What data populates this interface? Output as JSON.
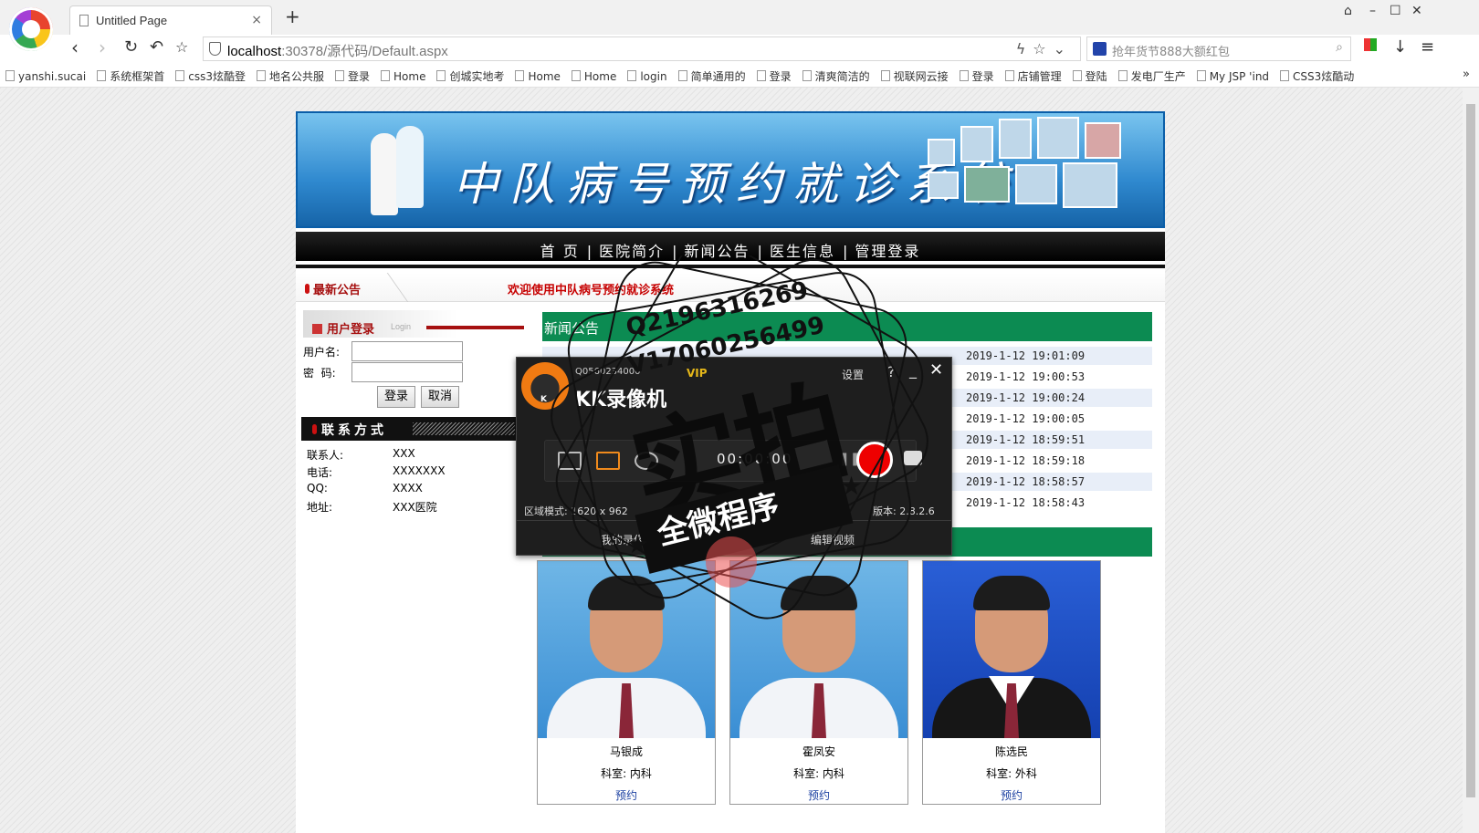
{
  "browser": {
    "tab_title": "Untitled Page",
    "tab_close": "×",
    "new_tab": "+",
    "url_host": "localhost",
    "url_rest": ":30378/源代码/Default.aspx",
    "search_placeholder": "抢年货节888大额红包",
    "bookmarks": [
      "yanshi.sucai",
      "系统框架首",
      "css3炫酷登",
      "地名公共服",
      "登录",
      "Home",
      "创城实地考",
      "Home",
      "Home",
      "login",
      "简单通用的",
      "登录",
      "清爽简洁的",
      "视联网云接",
      "登录",
      "店铺管理",
      "登陆",
      "发电厂生产",
      "My JSP 'ind",
      "CSS3炫酷动"
    ],
    "bookmarks_more": "»"
  },
  "site": {
    "banner_title": "中队病号预约就诊系统",
    "menu": [
      "首 页",
      "医院简介",
      "新闻公告",
      "医生信息",
      "管理登录"
    ],
    "notice_label": "最新公告",
    "notice_text": "欢迎使用中队病号预约就诊系统",
    "login": {
      "title": "用户登录",
      "subtitle": "Login",
      "username_label": "用户名:",
      "password_label": "密  码:",
      "username_value": "",
      "password_value": "",
      "submit": "登录",
      "cancel": "取消"
    },
    "contact": {
      "title": "联系方式",
      "rows": [
        {
          "label": "联系人:",
          "value": "XXX"
        },
        {
          "label": "电话:",
          "value": "XXXXXXX"
        },
        {
          "label": "QQ:",
          "value": "XXXX"
        },
        {
          "label": "地址:",
          "value": "XXX医院"
        }
      ]
    },
    "news": {
      "title": "新闻公告",
      "dates": [
        "2019-1-12 19:01:09",
        "2019-1-12 19:00:53",
        "2019-1-12 19:00:24",
        "2019-1-12 19:00:05",
        "2019-1-12 18:59:51",
        "2019-1-12 18:59:18",
        "2019-1-12 18:58:57",
        "2019-1-12 18:58:43"
      ]
    },
    "doctors": [
      {
        "name": "马银成",
        "dept": "科室: 内科",
        "book": "预约"
      },
      {
        "name": "霍凤安",
        "dept": "科室: 内科",
        "book": "预约"
      },
      {
        "name": "陈选民",
        "dept": "科室: 外科",
        "book": "预约"
      }
    ]
  },
  "recorder": {
    "account": "Q0560234000",
    "vip": "VIP",
    "name": "KK录像机",
    "settings": "设置",
    "help": "?",
    "minimize": "_",
    "close": "✕",
    "timer": "00:00:00",
    "region": "区域模式: 1620 x 962",
    "version": "版本: 2.8.2.6",
    "tab_my_videos": "我的录像",
    "tab_edit_video": "编辑视频"
  },
  "watermark": {
    "line1": "Q2196316269",
    "line2": "V17060256499",
    "big": "实拍",
    "banner": "全微程序"
  },
  "colors": {
    "menu_bg": "#000000",
    "news_header": "#0c8b52",
    "notice_red": "#c60000",
    "link_blue": "#1a3fa0",
    "record_red": "#e00000"
  }
}
